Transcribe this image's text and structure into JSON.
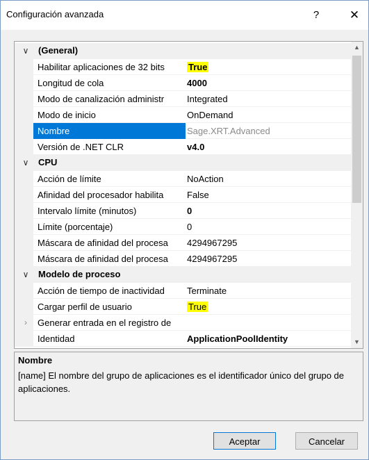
{
  "window": {
    "title": "Configuración avanzada",
    "help": "?",
    "close": "✕"
  },
  "categories": [
    {
      "label": "(General)",
      "toggle": "∨",
      "props": [
        {
          "name": "Habilitar aplicaciones de 32 bits",
          "value": "True",
          "bold": true,
          "highlight": true
        },
        {
          "name": "Longitud de cola",
          "value": "4000",
          "bold": true
        },
        {
          "name": "Modo de canalización administr",
          "value": "Integrated"
        },
        {
          "name": "Modo de inicio",
          "value": "OnDemand"
        },
        {
          "name": "Nombre",
          "value": "Sage.XRT.Advanced",
          "selected": true,
          "grey": true
        },
        {
          "name": "Versión de .NET CLR",
          "value": "v4.0",
          "bold": true
        }
      ]
    },
    {
      "label": "CPU",
      "toggle": "∨",
      "props": [
        {
          "name": "Acción de límite",
          "value": "NoAction"
        },
        {
          "name": "Afinidad del procesador habilita",
          "value": "False"
        },
        {
          "name": "Intervalo límite (minutos)",
          "value": "0",
          "bold": true
        },
        {
          "name": "Límite (porcentaje)",
          "value": "0"
        },
        {
          "name": "Máscara de afinidad del procesa",
          "value": "4294967295"
        },
        {
          "name": "Máscara de afinidad del procesa",
          "value": "4294967295"
        }
      ]
    },
    {
      "label": "Modelo de proceso",
      "toggle": "∨",
      "props": [
        {
          "name": "Acción de tiempo de inactividad",
          "value": "Terminate"
        },
        {
          "name": "Cargar perfil de usuario",
          "value": "True",
          "highlight": true
        },
        {
          "name": "Generar entrada en el registro de",
          "value": "",
          "expander": "›"
        },
        {
          "name": "Identidad",
          "value": "ApplicationPoolIdentity",
          "bold": true
        }
      ]
    }
  ],
  "scroll": {
    "up": "▲",
    "down": "▼"
  },
  "description": {
    "title": "Nombre",
    "text": "[name] El nombre del grupo de aplicaciones es el identificador único del grupo de aplicaciones."
  },
  "buttons": {
    "ok": "Aceptar",
    "cancel": "Cancelar"
  }
}
